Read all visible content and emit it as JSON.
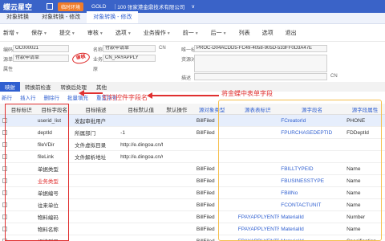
{
  "topbar": {
    "logo": "蝶云星空",
    "badge": "临时环境",
    "product": "GOLD",
    "org": "100 张家港金鼎技术有限公司",
    "extra": "∨"
  },
  "tabs": [
    {
      "label": "对象转换"
    },
    {
      "label": "对象转换 - 修改"
    },
    {
      "label": "对象转换 - 修改",
      "active": true
    }
  ],
  "toolbar": [
    {
      "label": "新增",
      "caret": true
    },
    {
      "label": "保存",
      "caret": true
    },
    {
      "label": "提交",
      "caret": true
    },
    {
      "label": "审核",
      "caret": true
    },
    {
      "label": "选项",
      "caret": true
    },
    {
      "label": "业务操作",
      "caret": true
    },
    {
      "label": "前一",
      "caret": true
    },
    {
      "label": "后一",
      "caret": true
    },
    {
      "label": "列表"
    },
    {
      "label": "选项"
    },
    {
      "label": "退出"
    }
  ],
  "form": {
    "code_label": "编码",
    "code_value": "OC000021",
    "name_label": "名称",
    "name_value": "付款申请单",
    "name_suffix": "CN",
    "id_label": "唯一标识",
    "id_value": "PROC-D04ACDD5-FC49-4058-905D-533FF0D3A47E",
    "source_label": "源单",
    "source_value": "付款申请单",
    "biz_label": "业务对象",
    "biz_value": "CN_PAYAPPLY",
    "resource_label": "资源对象",
    "resource_value": "",
    "note_label": "描述",
    "note_value": "",
    "note_suffix": "CN",
    "stamp": "审核"
  },
  "subtabs": [
    {
      "label": "映射",
      "active": true
    },
    {
      "label": "转换前检查"
    },
    {
      "label": "转换后处理"
    },
    {
      "label": "其他"
    }
  ],
  "subtoolbar": [
    {
      "label": "新行"
    },
    {
      "label": "插入行"
    },
    {
      "label": "删除行"
    },
    {
      "label": "批量填充"
    },
    {
      "label": "重置序号"
    }
  ],
  "annotations": {
    "left": "钉钉控件字段名",
    "right": "将金蝶中表单字段"
  },
  "table": {
    "headers": [
      {
        "label": "",
        "col": "c0"
      },
      {
        "label": "目标标识",
        "col": "c1"
      },
      {
        "label": "目标字段名",
        "col": "c2"
      },
      {
        "label": "目标描述",
        "col": "c3"
      },
      {
        "label": "目标默认值",
        "col": "c4"
      },
      {
        "label": "默认操作",
        "col": "c5"
      },
      {
        "label": "",
        "col": "c6"
      },
      {
        "label": "源对象类型",
        "col": "c7",
        "blue": true
      },
      {
        "label": "",
        "col": "c8"
      },
      {
        "label": "源表表标识",
        "col": "c9",
        "blue": true
      },
      {
        "label": "源字段名",
        "col": "c10",
        "blue": true
      },
      {
        "label": "源字段属性",
        "col": "c11",
        "blue": true
      }
    ],
    "rows": [
      {
        "c1": "",
        "c2": "userid_list",
        "c3": "发起审批用户",
        "c4": "",
        "c5": "",
        "c7": "BillFiled",
        "c9": "",
        "c10": "FCreatorId",
        "c11": "PHONE",
        "sel": true
      },
      {
        "c1": "",
        "c2": "deptId",
        "c3": "所属部门",
        "c4": "-1",
        "c5": "",
        "c7": "BillFiled",
        "c9": "",
        "c10": "FPURCHASEDEPTID",
        "c11": "FDDeptId"
      },
      {
        "c1": "",
        "c2": "fileVDir",
        "c3": "文件虚拟目录",
        "c4": "http://e.dingoa.cn/f/",
        "c5": "",
        "c7": "",
        "c9": "",
        "c10": "",
        "c11": ""
      },
      {
        "c1": "",
        "c2": "fileLink",
        "c3": "文件解析地址",
        "c4": "http://e.dingoa.cn/G...",
        "c5": "",
        "c7": "",
        "c9": "",
        "c10": "",
        "c11": ""
      },
      {
        "c1": "",
        "c2": "单据类型",
        "c3": "",
        "c4": "",
        "c5": "",
        "c7": "BillFiled",
        "c9": "",
        "c10": "FBILLTYPEID",
        "c11": "Name"
      },
      {
        "c1": "",
        "c2": "业务类型",
        "c3": "",
        "c4": "",
        "c5": "",
        "c7": "BillFiled",
        "c9": "",
        "c10": "FBUSINESSTYPE",
        "c11": "Name",
        "red": true
      },
      {
        "c1": "",
        "c2": "单据编号",
        "c3": "",
        "c4": "",
        "c5": "",
        "c7": "BillFiled",
        "c9": "",
        "c10": "FBillNo",
        "c11": "Name"
      },
      {
        "c1": "",
        "c2": "往来单位",
        "c3": "",
        "c4": "",
        "c5": "",
        "c7": "BillFiled",
        "c9": "",
        "c10": "FCONTACTUNIT",
        "c11": "Name"
      },
      {
        "c1": "",
        "c2": "物料编码",
        "c3": "",
        "c4": "",
        "c5": "",
        "c7": "BillFiled",
        "c9": "FPAYAPPLYENTRY",
        "c10": "MaterialId",
        "c11": "Number"
      },
      {
        "c1": "",
        "c2": "物料名称",
        "c3": "",
        "c4": "",
        "c5": "",
        "c7": "BillFiled",
        "c9": "FPAYAPPLYENTRY",
        "c10": "MaterialId",
        "c11": "Name"
      },
      {
        "c1": "",
        "c2": "规格型号",
        "c3": "",
        "c4": "",
        "c5": "",
        "c7": "BillFiled",
        "c9": "FPAYAPPLYENTRY",
        "c10": "MaterialId",
        "c11": "Specification"
      }
    ]
  }
}
